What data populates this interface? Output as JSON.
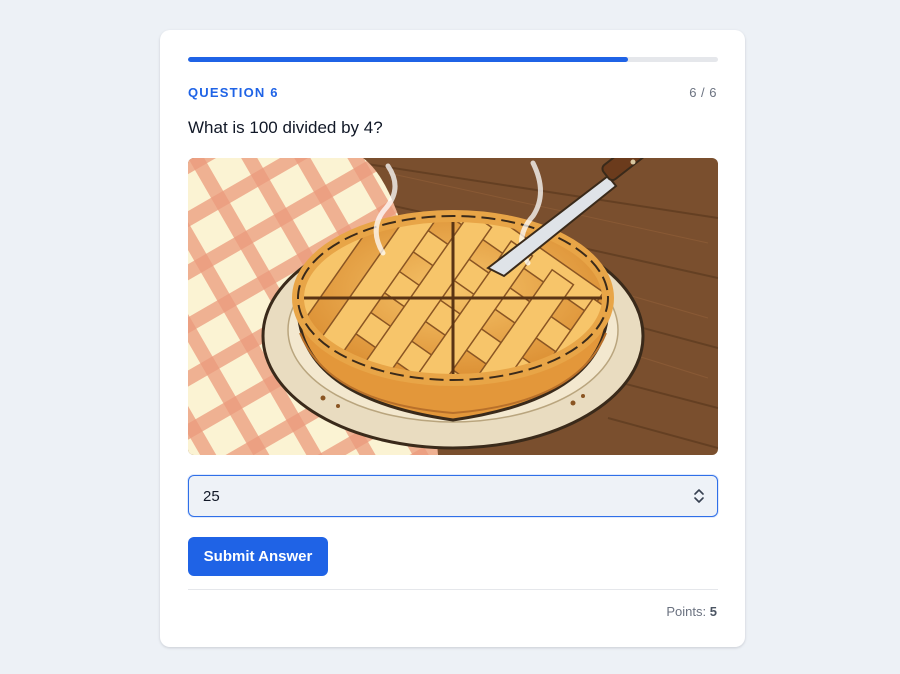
{
  "progress": {
    "fraction": 0.83,
    "color": "#1f63e6"
  },
  "question": {
    "label": "QUESTION 6",
    "counter": "6 / 6",
    "text": "What is 100 divided by 4?"
  },
  "image": {
    "subject": "pie-with-knife-illustration"
  },
  "answer": {
    "value": "25"
  },
  "submit": {
    "label": "Submit Answer"
  },
  "footer": {
    "points_label": "Points:",
    "points_value": "5"
  },
  "colors": {
    "accent": "#1f63e6",
    "background": "#edf1f6"
  }
}
